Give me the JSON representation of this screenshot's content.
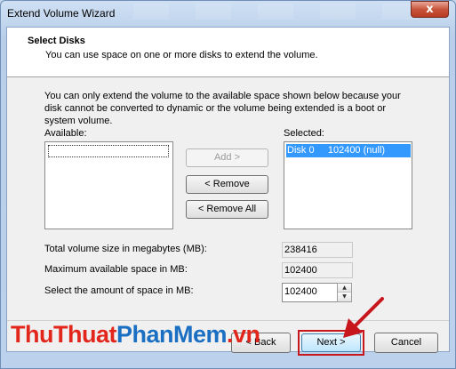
{
  "window": {
    "title": "Extend Volume Wizard",
    "close_glyph": "x"
  },
  "header": {
    "title": "Select Disks",
    "subtitle": "You can use space on one or more disks to extend the volume."
  },
  "info": "You can only extend the volume to the available space shown below because your disk cannot be converted to dynamic or the volume being extended is a boot or system volume.",
  "available": {
    "label": "Available:",
    "items": []
  },
  "selected": {
    "label": "Selected:",
    "items": [
      "Disk 0     102400 (null)"
    ]
  },
  "buttons": {
    "add": "Add >",
    "remove": "< Remove",
    "remove_all": "< Remove All",
    "back": "< Back",
    "next": "Next >",
    "cancel": "Cancel"
  },
  "fields": {
    "total_label": "Total volume size in megabytes (MB):",
    "total_value": "238416",
    "max_label": "Maximum available space in MB:",
    "max_value": "102400",
    "amount_label": "Select the amount of space in MB:",
    "amount_value": "102400"
  },
  "watermark": {
    "part1": "ThuThuat",
    "part2": "PhanMem",
    "part3": ".vn"
  },
  "colors": {
    "highlight": "#3399ff",
    "annotation_red": "#c8161d",
    "watermark_red": "#e2261c",
    "watermark_blue": "#1a6fc2"
  }
}
